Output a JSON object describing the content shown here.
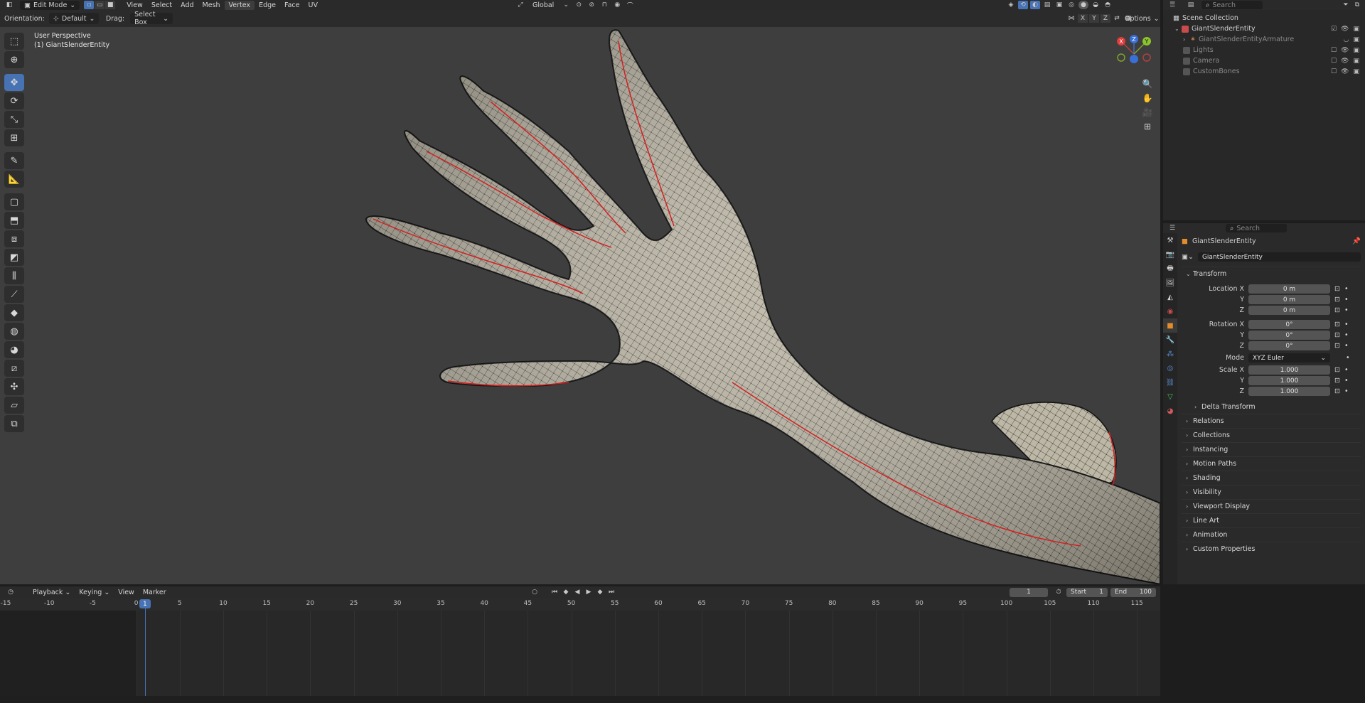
{
  "header": {
    "mode": "Edit Mode",
    "menus": [
      "View",
      "Select",
      "Add",
      "Mesh",
      "Vertex",
      "Edge",
      "Face",
      "UV"
    ],
    "active_menu": "Vertex",
    "transform_orientation": "Global",
    "options_label": "Options",
    "axis_x": "X",
    "axis_y": "Y",
    "axis_z": "Z"
  },
  "toolsettings": {
    "orientation_label": "Orientation:",
    "orientation_value": "Default",
    "drag_label": "Drag:",
    "drag_value": "Select Box"
  },
  "viewport": {
    "perspective": "User Perspective",
    "object": "(1) GiantSlenderEntity"
  },
  "gizmo": {
    "x": "X",
    "y": "Y",
    "z": "Z"
  },
  "outliner": {
    "search_placeholder": "Search",
    "scene_collection": "Scene Collection",
    "items": [
      {
        "label": "GiantSlenderEntity"
      },
      {
        "label": "GiantSlenderEntityArmature"
      },
      {
        "label": "Lights"
      },
      {
        "label": "Camera"
      },
      {
        "label": "CustomBones"
      }
    ]
  },
  "properties": {
    "search_placeholder": "Search",
    "object_name": "GiantSlenderEntity",
    "object_field": "GiantSlenderEntity",
    "transform_title": "Transform",
    "location_label": "Location X",
    "location": [
      "0 m",
      "0 m",
      "0 m"
    ],
    "rotation_label": "Rotation X",
    "rotation": [
      "0°",
      "0°",
      "0°"
    ],
    "mode_label": "Mode",
    "mode_value": "XYZ Euler",
    "scale_label": "Scale X",
    "scale": [
      "1.000",
      "1.000",
      "1.000"
    ],
    "y_label": "Y",
    "z_label": "Z",
    "delta_transform": "Delta Transform",
    "panels": [
      "Relations",
      "Collections",
      "Instancing",
      "Motion Paths",
      "Shading",
      "Visibility",
      "Viewport Display",
      "Line Art",
      "Animation",
      "Custom Properties"
    ]
  },
  "timeline": {
    "menus": [
      "Playback",
      "Keying",
      "View",
      "Marker"
    ],
    "current_frame": "1",
    "start_label": "Start",
    "start": "1",
    "end_label": "End",
    "end": "100",
    "ticks": [
      "-15",
      "-10",
      "-5",
      "0",
      "5",
      "10",
      "15",
      "20",
      "25",
      "30",
      "35",
      "40",
      "45",
      "50",
      "55",
      "60",
      "65",
      "70",
      "75",
      "80",
      "85",
      "90",
      "95",
      "100",
      "105",
      "110",
      "115"
    ],
    "playhead": "1"
  }
}
